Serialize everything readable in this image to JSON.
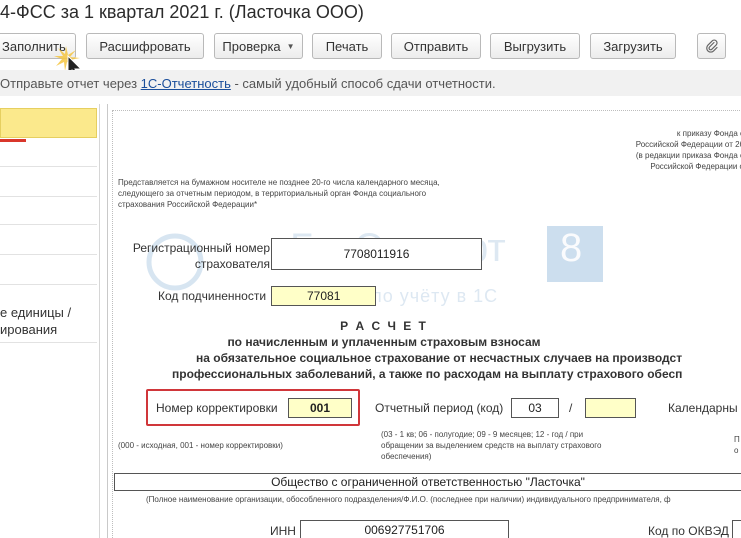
{
  "title": "4-ФСС за 1 квартал 2021 г. (Ласточка ООО)",
  "toolbar": {
    "fill_label": "Заполнить",
    "decode_label": "Расшифровать",
    "check_label": "Проверка",
    "check_arrow": "▼",
    "print_label": "Печать",
    "send_label": "Отправить",
    "unload_label": "Выгрузить",
    "load_label": "Загрузить"
  },
  "infobar": {
    "prefix": "Отправьте отчет через ",
    "link": "1С-Отчетность",
    "suffix": " - самый удобный способ сдачи отчетности."
  },
  "left_panel": {
    "item_line1": "е единицы /",
    "item_line2": "ирования"
  },
  "form": {
    "order_ref": [
      "к приказу Фонда с",
      "Российской Федерации от 26",
      "(в редакции приказа Фонда с",
      "Российской Федерации о"
    ],
    "note": [
      "Представляется на бумажном носителе не позднее 20-го числа календарного месяца,",
      "следующего за отчетным периодом, в территориальный орган Фонда социального",
      "страхования Российской Федерации*"
    ],
    "reg_number_label1": "Регистрационный номер",
    "reg_number_label2": "страхователя",
    "reg_number_value": "7708011916",
    "sub_code_label": "Код подчиненности",
    "sub_code_value": "77081",
    "heading1": "Р А С Ч Е Т",
    "heading2": "по начисленным и уплаченным страховым взносам",
    "heading3": "на обязательное социальное страхование от несчастных случаев на производст",
    "heading4": "профессиональных заболеваний, а также по расходам на выплату страхового обесп",
    "correction_label": "Номер корректировки",
    "correction_value": "001",
    "period_label": "Отчетный период (код)",
    "period_value": "03",
    "period_sep": "/",
    "period_value2": "",
    "calendar_label": "Календарны",
    "correction_hint": "(000 - исходная, 001 - номер корректировки)",
    "period_hint": [
      "(03 - 1 кв; 06 - полугодие; 09 - 9 месяцев; 12 - год / при",
      "обращении за выделением средств на выплату страхового",
      "обеспечения)"
    ],
    "right_hint": [
      "П",
      "о"
    ],
    "org_name": "Общество с ограниченной ответственностью \"Ласточка\"",
    "org_hint": "(Полное наименование организации, обособленного подразделения/Ф.И.О. (последнее при наличии) индивидуального предпринимателя, ф",
    "inn_label": "ИНН",
    "inn_value": "006927751706",
    "okved_label": "Код по ОКВЭД"
  },
  "watermark": {
    "brand": "БухЭксперт",
    "digit": "8",
    "tagline": "Экспертов по учёту в 1С"
  },
  "colors": {
    "accent_yellow": "#ffffc8",
    "active_item": "#fbe98c",
    "highlight_red": "#d0363a",
    "link": "#1a4e9b"
  }
}
